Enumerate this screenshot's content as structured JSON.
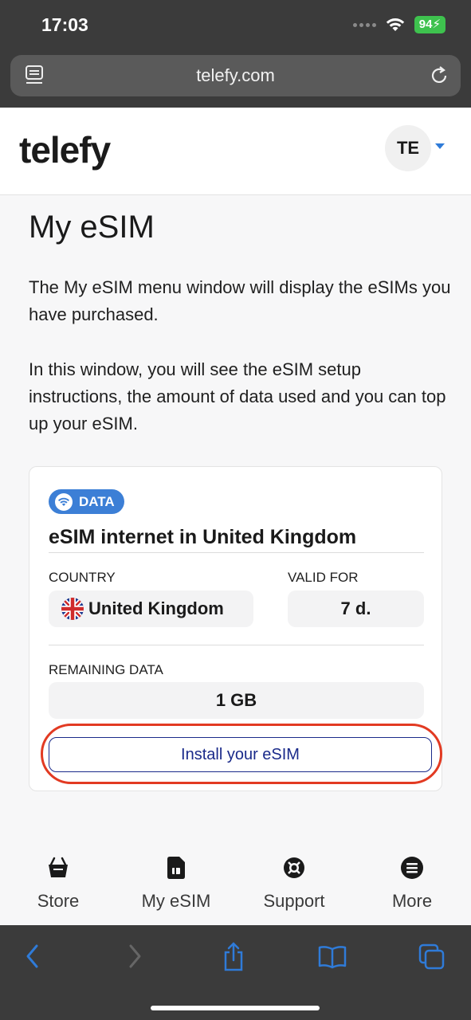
{
  "status_bar": {
    "time": "17:03",
    "battery": "94"
  },
  "browser": {
    "url": "telefy.com"
  },
  "header": {
    "logo": "telefy",
    "avatar_initials": "TE"
  },
  "main": {
    "title": "My eSIM",
    "description_1": "The My eSIM menu window will display the eSIMs you have purchased.",
    "description_2": "In this window, you will see the eSIM setup instructions, the amount of data used and you can top up your eSIM."
  },
  "esim_card": {
    "badge": "DATA",
    "title": "eSIM internet in United Kingdom",
    "country_label": "COUNTRY",
    "country_value": "United Kingdom",
    "valid_label": "VALID FOR",
    "valid_value": "7 d.",
    "remaining_label": "REMAINING DATA",
    "remaining_value": "1 GB",
    "install_button": "Install your eSIM"
  },
  "site_nav": {
    "items": [
      {
        "label": "Store",
        "icon": "basket-icon"
      },
      {
        "label": "My eSIM",
        "icon": "sim-card-icon"
      },
      {
        "label": "Support",
        "icon": "lifebuoy-icon"
      },
      {
        "label": "More",
        "icon": "menu-icon"
      }
    ]
  },
  "colors": {
    "accent_blue": "#3c7fd6",
    "button_navy": "#1a2a8a",
    "highlight_red": "#e23a22",
    "safari_blue": "#2f7bd8"
  }
}
